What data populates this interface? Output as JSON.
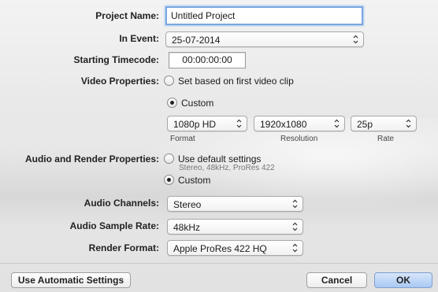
{
  "form": {
    "project_name": {
      "label": "Project Name:",
      "value": "Untitled Project"
    },
    "in_event": {
      "label": "In Event:",
      "value": "25-07-2014"
    },
    "starting_timecode": {
      "label": "Starting Timecode:",
      "value": "00:00:00:00"
    },
    "video_properties": {
      "label": "Video Properties:",
      "options": [
        {
          "label": "Set based on first video clip",
          "selected": false
        },
        {
          "label": "Custom",
          "selected": true
        }
      ],
      "format": {
        "value": "1080p HD",
        "caption": "Format"
      },
      "resolution": {
        "value": "1920x1080",
        "caption": "Resolution"
      },
      "rate": {
        "value": "25p",
        "caption": "Rate"
      }
    },
    "audio_render_properties": {
      "label": "Audio and Render Properties:",
      "options": [
        {
          "label": "Use default settings",
          "subtitle": "Stereo, 48kHz, ProRes 422",
          "selected": false
        },
        {
          "label": "Custom",
          "selected": true
        }
      ]
    },
    "audio_channels": {
      "label": "Audio Channels:",
      "value": "Stereo"
    },
    "audio_sample_rate": {
      "label": "Audio Sample Rate:",
      "value": "48kHz"
    },
    "render_format": {
      "label": "Render Format:",
      "value": "Apple ProRes 422 HQ"
    }
  },
  "footer": {
    "automatic_label": "Use Automatic Settings",
    "cancel_label": "Cancel",
    "ok_label": "OK"
  },
  "icons": {
    "popup": "chevron-updown-icon"
  },
  "colors": {
    "focus_ring": "#7aa7e0",
    "default_button": "#aac9f2"
  }
}
